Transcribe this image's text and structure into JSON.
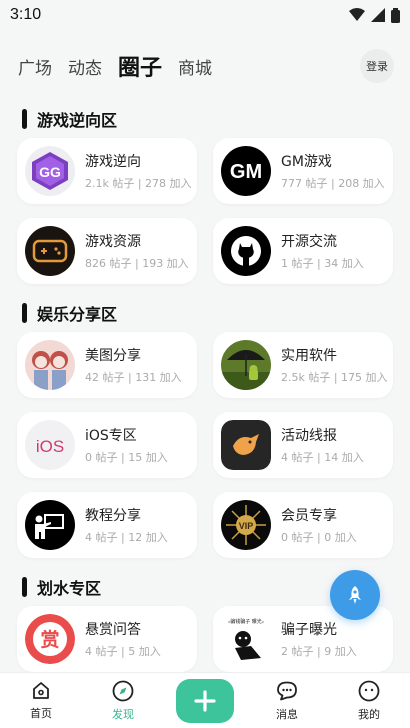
{
  "status": {
    "time": "3:10"
  },
  "topnav": {
    "tabs": [
      "广场",
      "动态",
      "圈子",
      "商城"
    ],
    "login": "登录"
  },
  "sections": [
    {
      "title": "游戏逆向区",
      "cards": [
        {
          "name": "游戏逆向",
          "stats": "2.1k 帖子 | 278 加入",
          "icon": "gameguardian-icon"
        },
        {
          "name": "GM游戏",
          "stats": "777 帖子 | 208 加入",
          "icon": "gm-logo-icon"
        },
        {
          "name": "游戏资源",
          "stats": "826 帖子 | 193 加入",
          "icon": "gamepad-icon"
        },
        {
          "name": "开源交流",
          "stats": "1 帖子 | 34 加入",
          "icon": "github-icon"
        }
      ]
    },
    {
      "title": "娱乐分享区",
      "cards": [
        {
          "name": "美图分享",
          "stats": "42 帖子 | 131 加入",
          "icon": "anime-girls-icon"
        },
        {
          "name": "实用软件",
          "stats": "2.5k 帖子 | 175 加入",
          "icon": "android-umbrella-icon"
        },
        {
          "name": "iOS专区",
          "stats": "0 帖子 | 15 加入",
          "icon": "ios-icon"
        },
        {
          "name": "活动线报",
          "stats": "4 帖子 | 14 加入",
          "icon": "bird-icon"
        },
        {
          "name": "教程分享",
          "stats": "4 帖子 | 12 加入",
          "icon": "teacher-icon"
        },
        {
          "name": "会员专享",
          "stats": "0 帖子 | 0 加入",
          "icon": "vip-badge-icon"
        }
      ]
    },
    {
      "title": "划水专区",
      "cards": [
        {
          "name": "悬赏问答",
          "stats": "4 帖子 | 5 加入",
          "icon": "reward-icon"
        },
        {
          "name": "骗子曝光",
          "stats": "2 帖子 | 9 加入",
          "icon": "meme-icon"
        }
      ]
    }
  ],
  "meme_caption": "《骗钱骗子 曝光》",
  "reward_char": "赏",
  "bottom_nav": {
    "home": "首页",
    "discover": "发现",
    "messages": "消息",
    "mine": "我的"
  },
  "colors": {
    "accent": "#3dc49a",
    "active_label": "#3bb38f",
    "rocket": "#3d9be8"
  }
}
